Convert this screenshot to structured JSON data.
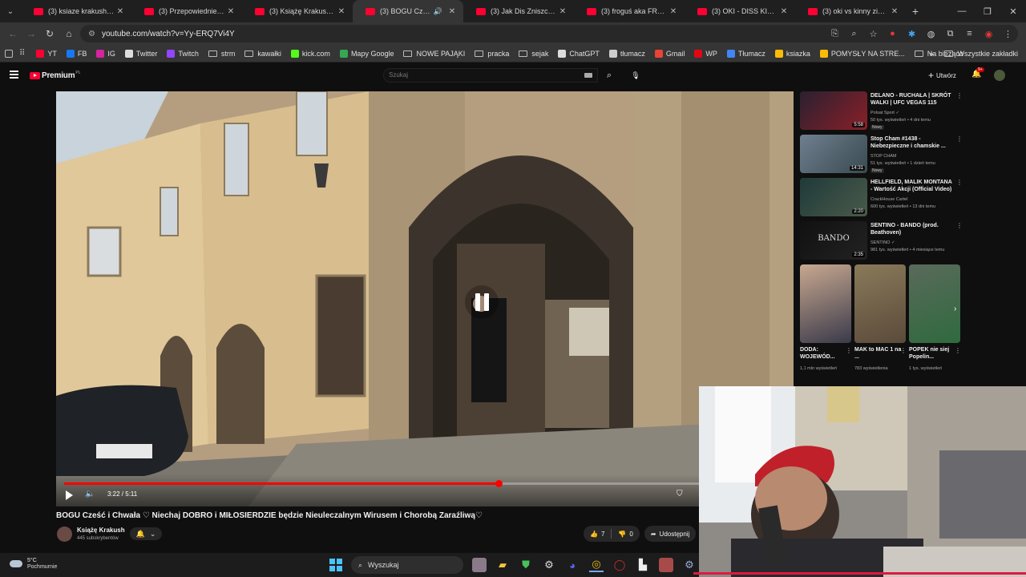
{
  "browser": {
    "tabs": [
      {
        "title": "(3) ksiaze krakush - YouTube",
        "active": false
      },
      {
        "title": "(3) Przepowiednie Prześwi...",
        "active": false
      },
      {
        "title": "(3) Książę Krakush - YouTube",
        "active": false
      },
      {
        "title": "(3) BOGU Cześć i Chwała",
        "active": true
      },
      {
        "title": "(3) Jak Dis Zniszczył Swoje...",
        "active": false
      },
      {
        "title": "(3) froguś aka FROG wbija...",
        "active": false
      },
      {
        "title": "(3) OKI - DISS KINNY ZIMM...",
        "active": false
      },
      {
        "title": "(3) oki vs kinny zimmer -",
        "active": false
      }
    ],
    "url": "youtube.com/watch?v=Yy-ERQ7Vi4Y",
    "bookmarks": [
      {
        "label": "YT",
        "color": "#ff0033"
      },
      {
        "label": "FB",
        "color": "#1877f2"
      },
      {
        "label": "IG",
        "color": "#d6249f"
      },
      {
        "label": "Twitter",
        "color": "#dddddd"
      },
      {
        "label": "Twitch",
        "color": "#9146ff"
      },
      {
        "label": "strm",
        "folder": true
      },
      {
        "label": "kawałki",
        "folder": true
      },
      {
        "label": "kick.com",
        "color": "#53fc18"
      },
      {
        "label": "Mapy Google",
        "color": "#34a853"
      },
      {
        "label": "NOWE PAJĄKI",
        "folder": true
      },
      {
        "label": "pracka",
        "folder": true
      },
      {
        "label": "sejak",
        "folder": true
      },
      {
        "label": "ChatGPT",
        "color": "#dddddd"
      },
      {
        "label": "tłumacz",
        "color": "#cccccc"
      },
      {
        "label": "Gmail",
        "color": "#ea4335"
      },
      {
        "label": "WP",
        "color": "#e30613"
      },
      {
        "label": "Tłumacz",
        "color": "#4285f4"
      },
      {
        "label": "ksiazka",
        "color": "#fbbc05"
      },
      {
        "label": "POMYSŁY NA STRE...",
        "color": "#fbbc05"
      },
      {
        "label": "Na bieżąco",
        "folder": true
      }
    ],
    "bookmarks_more": "»",
    "all_bookmarks": "Wszystkie zakładki"
  },
  "youtube": {
    "logo": "Premium",
    "logo_region": "PL",
    "search_placeholder": "Szukaj",
    "create_label": "Utwórz",
    "notification_count": "9+",
    "video": {
      "progress_fraction": 0.63,
      "time": "3:22 / 5:11",
      "title": "BOGU Cześć i Chwała ♡ Niechaj DOBRO i MIŁOSIERDZIE będzie Nieuleczalnym Wirusem i Chorobą Zaraźliwą♡",
      "channel": "Książę Krakush",
      "subscribers": "445 subskrybentów",
      "likes": "7",
      "dislikes": "0",
      "share_label": "Udostępnij"
    },
    "recommendations": [
      {
        "title": "DELANO - RUCHAŁA | SKRÓT WALKI | UFC VEGAS 115",
        "channel": "Polsat Sport ✓",
        "meta": "50 tys. wyświetleń • 4 dni temu",
        "badge": "Nowy",
        "duration": "5:58",
        "colors": [
          "#2a2030",
          "#8a2028"
        ]
      },
      {
        "title": "Stop Cham #1438 - Niebezpieczne i chamskie ...",
        "channel": "STOP CHAM",
        "meta": "51 tys. wyświetleń • 1 dzień temu",
        "badge": "Nowy",
        "duration": "14:31",
        "colors": [
          "#6f7f8f",
          "#3a4a50"
        ]
      },
      {
        "title": "HELLFIELD, MALIK MONTANA - Wartość Akcji (Official Video)",
        "channel": "CrackHouse Cartel",
        "meta": "600 tys. wyświetleń • 13 dni temu",
        "badge": "",
        "duration": "2:20",
        "colors": [
          "#1f3a3a",
          "#4a5a4a"
        ]
      },
      {
        "title": "SENTINO - BANDO (prod. Beathoven)",
        "channel": "SENTINO ✓",
        "meta": "981 tys. wyświetleń • 4 miesiące temu",
        "badge": "",
        "duration": "2:35",
        "thumb_text": "BANDO",
        "colors": [
          "#111111",
          "#222222"
        ]
      }
    ],
    "shorts": [
      {
        "title": "DODA: WOJEWÓD...",
        "views": "1,1 mln wyświetleń",
        "colors": [
          "#c8a890",
          "#3a3a4a"
        ]
      },
      {
        "title": "MAK to MAC 1 na ...",
        "views": "783 wyświetlenia",
        "colors": [
          "#8a7a5a",
          "#5a4a3a"
        ]
      },
      {
        "title": "POPEK nie siej Popelin...",
        "views": "1 tys. wyświetleń",
        "colors": [
          "#5a6a5a",
          "#2f6a3f"
        ]
      }
    ]
  },
  "taskbar": {
    "temperature": "5°C",
    "weather": "Pochmurnie",
    "search_label": "Wyszukaj"
  }
}
